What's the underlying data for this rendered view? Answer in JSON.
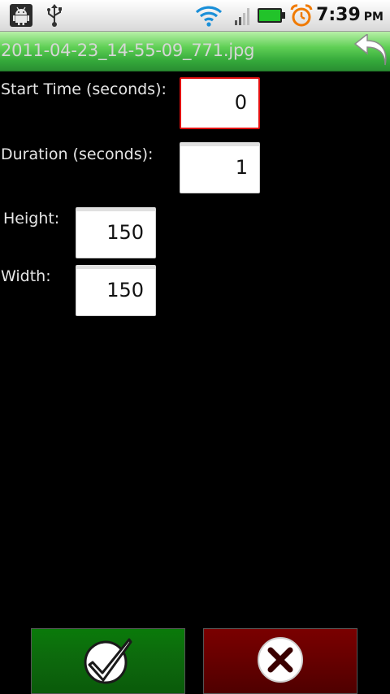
{
  "status_bar": {
    "time": "7:39",
    "ampm": "PM",
    "icons": [
      "android-debug-icon",
      "usb-icon",
      "wifi-icon",
      "signal-icon",
      "battery-icon",
      "alarm-icon"
    ]
  },
  "title_bar": {
    "title": "2011-04-23_14-55-09_771.jpg",
    "back_icon": "back-arrow-icon"
  },
  "form": {
    "start_time": {
      "label": "Start Time (seconds):",
      "value": "0",
      "focused": true
    },
    "duration": {
      "label": "Duration (seconds):",
      "value": "1"
    },
    "height": {
      "label": "Height:",
      "value": "150"
    },
    "width": {
      "label": "Width:",
      "value": "150"
    }
  },
  "actions": {
    "ok_icon": "checkmark-icon",
    "cancel_icon": "close-icon"
  },
  "colors": {
    "title_bar": "#3fb84a",
    "focus_border": "#e10f0f",
    "ok_button": "#0d6b0d",
    "cancel_button": "#6a0000"
  }
}
